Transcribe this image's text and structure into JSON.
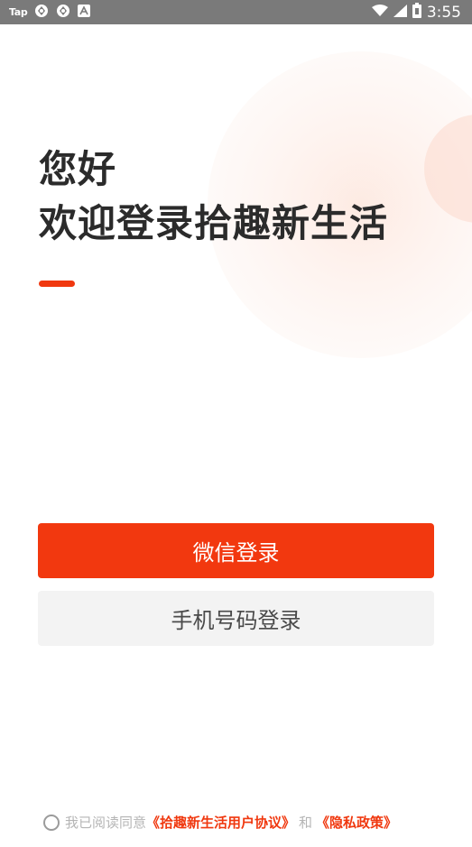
{
  "status_bar": {
    "app_label": "Tap",
    "time": "3:55"
  },
  "greeting": {
    "line1": "您好",
    "line2": "欢迎登录拾趣新生活"
  },
  "buttons": {
    "wechat_login": "微信登录",
    "phone_login": "手机号码登录"
  },
  "agreement": {
    "prefix": "我已阅读同意",
    "user_agreement": "《拾趣新生活用户协议》",
    "and": "和",
    "privacy_policy": "《隐私政策》"
  },
  "colors": {
    "accent": "#f2380f",
    "status_bar": "#7a7a7a",
    "secondary_button": "#f3f3f3"
  },
  "icons": {
    "status_left": [
      "tap-app-icon",
      "sync-icon",
      "sync-icon",
      "a-icon"
    ],
    "status_right": [
      "wifi-icon",
      "cellular-signal-icon",
      "battery-icon"
    ]
  }
}
